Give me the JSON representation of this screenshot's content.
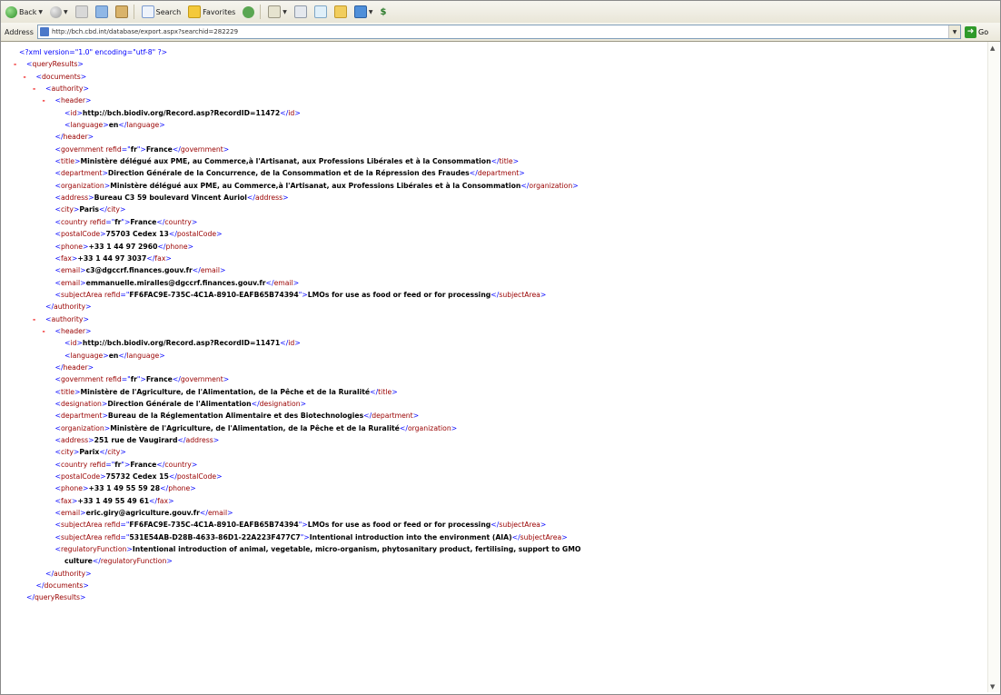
{
  "toolbar": {
    "back_label": "Back",
    "search_label": "Search",
    "favorites_label": "Favorites"
  },
  "address": {
    "label": "Address",
    "url": "http://bch.cbd.int/database/export.aspx?searchid=282229",
    "go_label": "Go"
  },
  "xml": {
    "decl": "<?xml version=\"1.0\" encoding=\"utf-8\" ?>",
    "lines": [
      {
        "toggle": "-",
        "indent": 0,
        "tag": "queryResults",
        "kind": "open"
      },
      {
        "toggle": "-",
        "indent": 1,
        "tag": "documents",
        "kind": "open"
      },
      {
        "toggle": "-",
        "indent": 2,
        "tag": "authority",
        "kind": "open"
      },
      {
        "toggle": "-",
        "indent": 3,
        "tag": "header",
        "kind": "open"
      },
      {
        "indent": 4,
        "tag": "id",
        "kind": "leaf",
        "text": "http://bch.biodiv.org/Record.asp?RecordID=11472"
      },
      {
        "indent": 4,
        "tag": "language",
        "kind": "leaf",
        "text": "en"
      },
      {
        "indent": 3,
        "tag": "header",
        "kind": "close"
      },
      {
        "indent": 3,
        "tag": "government",
        "kind": "leaf",
        "attr": "refid",
        "attrval": "fr",
        "text": "France"
      },
      {
        "indent": 3,
        "tag": "title",
        "kind": "leaf",
        "text": "Ministère délégué aux PME, au Commerce,à l'Artisanat, aux Professions Libérales et à la Consommation"
      },
      {
        "indent": 3,
        "tag": "department",
        "kind": "leaf",
        "text": "Direction Générale de la Concurrence, de la Consommation et de la Répression des Fraudes"
      },
      {
        "indent": 3,
        "tag": "organization",
        "kind": "leaf",
        "text": "Ministère délégué aux PME, au Commerce,à l'Artisanat, aux Professions Libérales et à la Consommation"
      },
      {
        "indent": 3,
        "tag": "address",
        "kind": "leaf",
        "text": "Bureau C3 59 boulevard Vincent Auriol"
      },
      {
        "indent": 3,
        "tag": "city",
        "kind": "leaf",
        "text": "Paris"
      },
      {
        "indent": 3,
        "tag": "country",
        "kind": "leaf",
        "attr": "refid",
        "attrval": "fr",
        "text": "France"
      },
      {
        "indent": 3,
        "tag": "postalCode",
        "kind": "leaf",
        "text": "75703 Cedex 13"
      },
      {
        "indent": 3,
        "tag": "phone",
        "kind": "leaf",
        "text": "+33 1 44 97 2960"
      },
      {
        "indent": 3,
        "tag": "fax",
        "kind": "leaf",
        "text": "+33 1 44 97 3037"
      },
      {
        "indent": 3,
        "tag": "email",
        "kind": "leaf",
        "text": "c3@dgccrf.finances.gouv.fr"
      },
      {
        "indent": 3,
        "tag": "email",
        "kind": "leaf",
        "text": "emmanuelle.miralles@dgccrf.finances.gouv.fr"
      },
      {
        "indent": 3,
        "tag": "subjectArea",
        "kind": "leaf",
        "attr": "refid",
        "attrval": "FF6FAC9E-735C-4C1A-8910-EAFB65B74394",
        "text": "LMOs for use as food or feed or for processing"
      },
      {
        "indent": 2,
        "tag": "authority",
        "kind": "close"
      },
      {
        "toggle": "-",
        "indent": 2,
        "tag": "authority",
        "kind": "open"
      },
      {
        "toggle": "-",
        "indent": 3,
        "tag": "header",
        "kind": "open"
      },
      {
        "indent": 4,
        "tag": "id",
        "kind": "leaf",
        "text": "http://bch.biodiv.org/Record.asp?RecordID=11471"
      },
      {
        "indent": 4,
        "tag": "language",
        "kind": "leaf",
        "text": "en"
      },
      {
        "indent": 3,
        "tag": "header",
        "kind": "close"
      },
      {
        "indent": 3,
        "tag": "government",
        "kind": "leaf",
        "attr": "refid",
        "attrval": "fr",
        "text": "France"
      },
      {
        "indent": 3,
        "tag": "title",
        "kind": "leaf",
        "text": "Ministère de l'Agriculture, de l'Alimentation, de la Pêche et de la Ruralité"
      },
      {
        "indent": 3,
        "tag": "designation",
        "kind": "leaf",
        "text": "Direction Générale de l'Alimentation"
      },
      {
        "indent": 3,
        "tag": "department",
        "kind": "leaf",
        "text": "Bureau de la Réglementation Alimentaire et des Biotechnologies"
      },
      {
        "indent": 3,
        "tag": "organization",
        "kind": "leaf",
        "text": "Ministère de l'Agriculture, de l'Alimentation, de la Pêche et de la Ruralité"
      },
      {
        "indent": 3,
        "tag": "address",
        "kind": "leaf",
        "text": "251 rue de Vaugirard"
      },
      {
        "indent": 3,
        "tag": "city",
        "kind": "leaf",
        "text": "Parix"
      },
      {
        "indent": 3,
        "tag": "country",
        "kind": "leaf",
        "attr": "refid",
        "attrval": "fr",
        "text": "France"
      },
      {
        "indent": 3,
        "tag": "postalCode",
        "kind": "leaf",
        "text": "75732 Cedex 15"
      },
      {
        "indent": 3,
        "tag": "phone",
        "kind": "leaf",
        "text": "+33 1 49 55 59 28"
      },
      {
        "indent": 3,
        "tag": "fax",
        "kind": "leaf",
        "text": "+33 1 49 55 49 61"
      },
      {
        "indent": 3,
        "tag": "email",
        "kind": "leaf",
        "text": "eric.giry@agriculture.gouv.fr"
      },
      {
        "indent": 3,
        "tag": "subjectArea",
        "kind": "leaf",
        "attr": "refid",
        "attrval": "FF6FAC9E-735C-4C1A-8910-EAFB65B74394",
        "text": "LMOs for use as food or feed or for processing"
      },
      {
        "indent": 3,
        "tag": "subjectArea",
        "kind": "leaf",
        "attr": "refid",
        "attrval": "531E54AB-D28B-4633-86D1-22A223F477C7",
        "text": "Intentional introduction into the environment (AIA)"
      },
      {
        "indent": 3,
        "tag": "regulatoryFunction",
        "kind": "wrapstart",
        "text": "Intentional introduction of animal, vegetable, micro-organism, phytosanitary product, fertilising, support to GMO"
      },
      {
        "indent": 4,
        "tag": "regulatoryFunction",
        "kind": "wrapend",
        "text": "culture"
      },
      {
        "indent": 2,
        "tag": "authority",
        "kind": "close"
      },
      {
        "indent": 1,
        "tag": "documents",
        "kind": "close"
      },
      {
        "indent": 0,
        "tag": "queryResults",
        "kind": "close"
      }
    ]
  }
}
